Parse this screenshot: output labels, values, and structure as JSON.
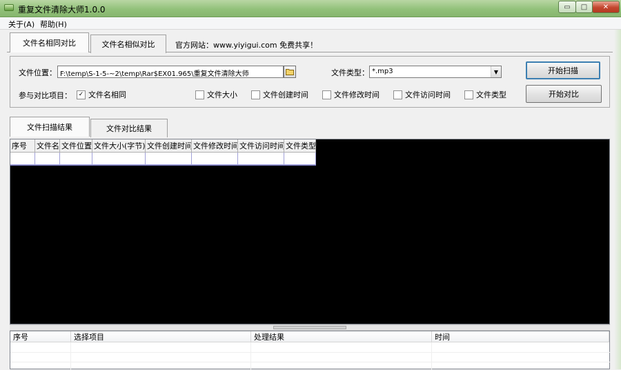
{
  "window": {
    "title": "重复文件清除大师1.0.0",
    "controls": {
      "minimize": "▭",
      "maximize": "□",
      "close": "✕"
    }
  },
  "menu": [
    {
      "label": "关于(A)"
    },
    {
      "label": "帮助(H)"
    }
  ],
  "top_tabs": [
    {
      "label": "文件名相同对比",
      "active": true
    },
    {
      "label": "文件名相似对比",
      "active": false
    }
  ],
  "site": {
    "label": "官方网站：www.yiyigui.com 免费共享！"
  },
  "panel": {
    "location_label": "文件位置：",
    "location_value": "F:\\temp\\S-1-5-~2\\temp\\Rar$EX01.965\\重复文件清除大师",
    "type_label": "文件类型：",
    "type_value": "*.mp3",
    "scan_button": "开始扫描",
    "compare_button": "开始对比",
    "compare_items_label": "参与对比项目：",
    "options": [
      {
        "label": "文件名相同",
        "checked": true
      },
      {
        "label": "文件大小",
        "checked": false
      },
      {
        "label": "文件创建时间",
        "checked": false
      },
      {
        "label": "文件修改时间",
        "checked": false
      },
      {
        "label": "文件访问时间",
        "checked": false
      },
      {
        "label": "文件类型",
        "checked": false
      }
    ]
  },
  "result_tabs": [
    {
      "label": "文件扫描结果",
      "active": true
    },
    {
      "label": "文件对比结果",
      "active": false
    }
  ],
  "results_table": {
    "columns": [
      "序号",
      "文件名",
      "文件位置",
      "文件大小(字节)",
      "文件创建时间",
      "文件修改时间",
      "文件访问时间",
      "文件类型"
    ]
  },
  "log_table": {
    "columns": [
      "序号",
      "选择项目",
      "处理结果",
      "时间"
    ]
  },
  "colors": {
    "titlebar": "#92c17a",
    "result_background": "#000000",
    "default_button_border": "#3c7fb1"
  }
}
